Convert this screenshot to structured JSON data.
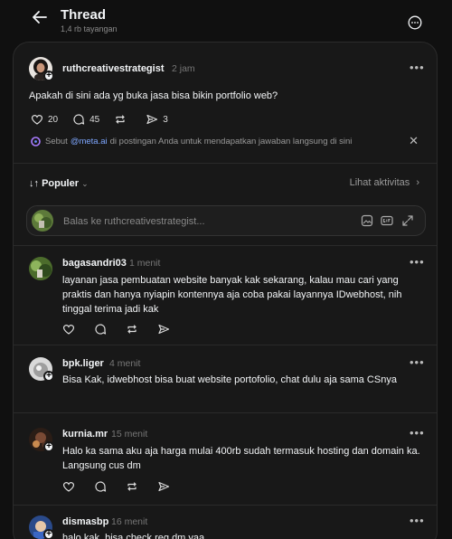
{
  "header": {
    "title": "Thread",
    "subtitle": "1,4 rb tayangan"
  },
  "post": {
    "username": "ruthcreativestrategist",
    "time": "2 jam",
    "text": "Apakah di sini ada yg buka jasa bisa bikin portfolio web?",
    "likes": "20",
    "comments": "45",
    "shares": "3"
  },
  "meta_ai": {
    "prefix": "Sebut",
    "link": "@meta.ai",
    "suffix": "di postingan Anda untuk mendapatkan jawaban langsung di sini"
  },
  "sort": {
    "label": "Populer",
    "activity_label": "Lihat aktivitas"
  },
  "reply_box": {
    "placeholder": "Balas ke ruthcreativestrategist..."
  },
  "replies": [
    {
      "username": "bagasandri03",
      "time": "1 menit",
      "text": "layanan jasa pembuatan website banyak kak sekarang, kalau mau cari yang praktis dan hanya nyiapin kontennya aja coba pakai layannya IDwebhost, nih tinggal terima jadi kak"
    },
    {
      "username": "bpk.liger",
      "time": "4 menit",
      "text": "Bisa Kak, idwebhost bisa buat website portofolio, chat dulu aja sama CSnya"
    },
    {
      "username": "kurnia.mr",
      "time": "15 menit",
      "text": "Halo ka sama aku aja harga mulai 400rb sudah termasuk hosting dan domain ka. Langsung cus dm"
    },
    {
      "username": "dismasbp",
      "time": "16 menit",
      "text": "halo kak, bisa check reg dm yaa"
    }
  ],
  "colors": {
    "background": "#101010",
    "panel": "#181818",
    "link": "#7ea7ff"
  }
}
